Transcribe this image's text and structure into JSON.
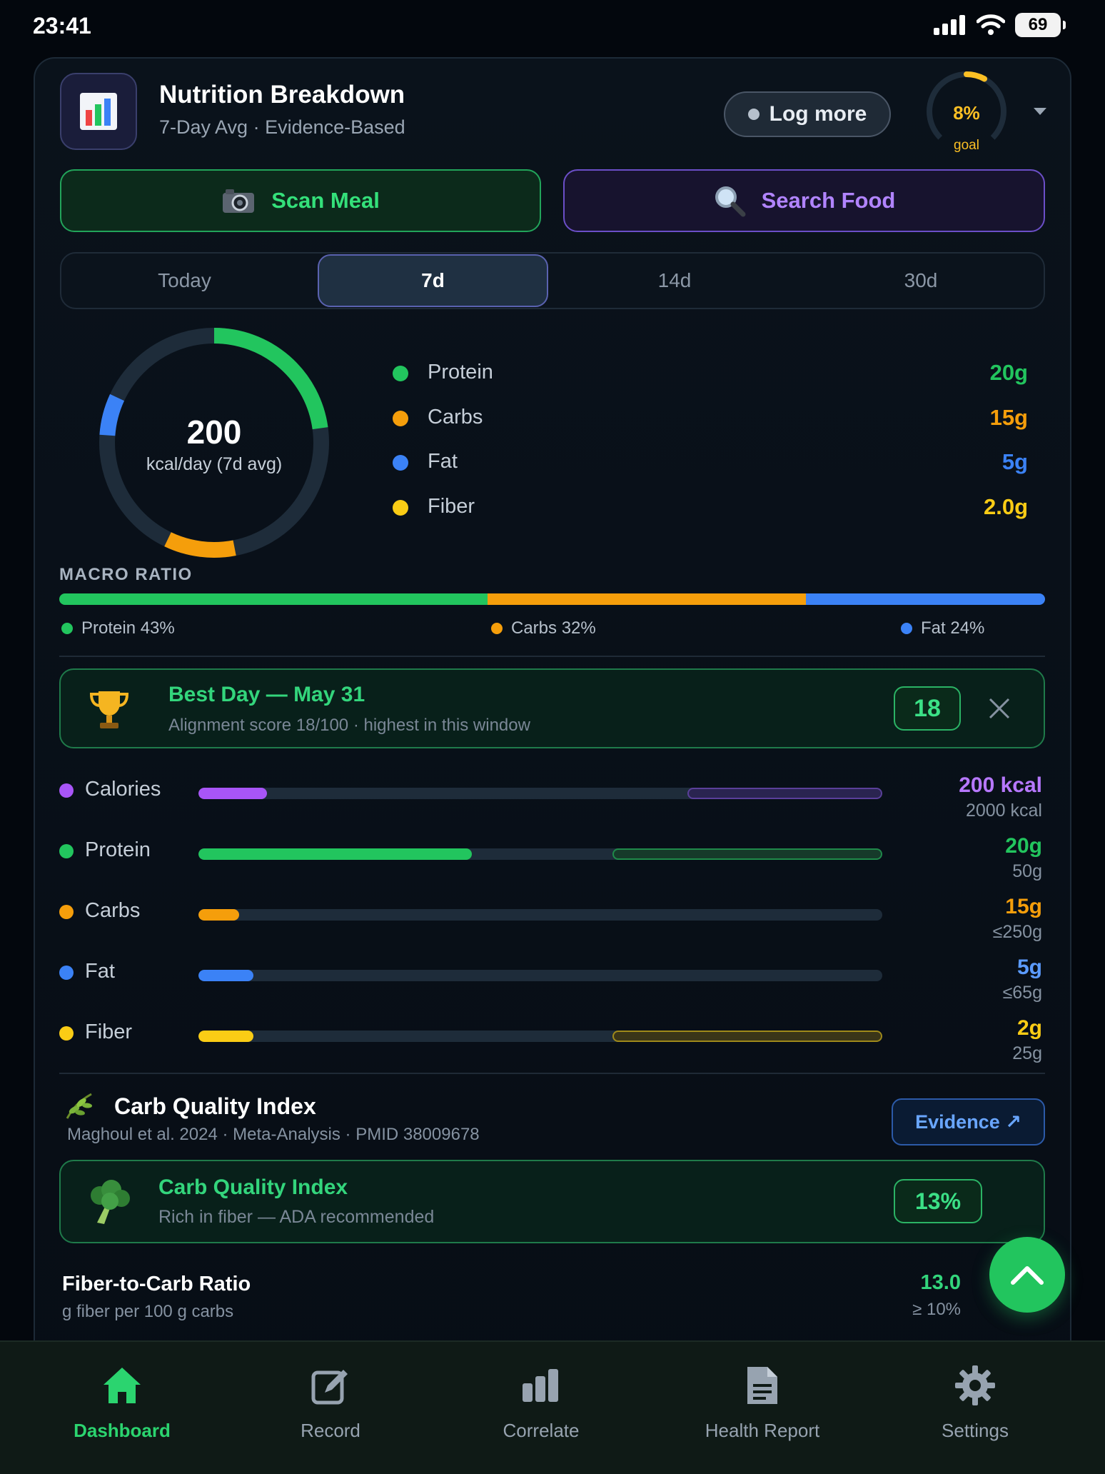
{
  "status": {
    "time": "23:41",
    "battery": "69"
  },
  "header": {
    "title": "Nutrition Breakdown",
    "subtitle": "7-Day Avg · Evidence-Based",
    "log_more": "Log more",
    "goal_pct": "8%",
    "goal_label": "goal",
    "goal_fraction": 0.08
  },
  "actions": {
    "scan": "Scan Meal",
    "search": "Search Food"
  },
  "periods": [
    "Today",
    "7d",
    "14d",
    "30d"
  ],
  "active_period": "7d",
  "ring": {
    "value": "200",
    "unit": "kcal/day (7d avg)"
  },
  "macros": [
    {
      "name": "Protein",
      "value": "20g",
      "color": "#22c55e"
    },
    {
      "name": "Carbs",
      "value": "15g",
      "color": "#f59e0b"
    },
    {
      "name": "Fat",
      "value": "5g",
      "color": "#3b82f6"
    },
    {
      "name": "Fiber",
      "value": "2.0g",
      "color": "#facc15"
    }
  ],
  "macro_ratio": {
    "title": "MACRO RATIO",
    "protein": "Protein 43%",
    "carbs": "Carbs 32%",
    "fat": "Fat 24%",
    "protein_pct": 43,
    "carbs_pct": 32,
    "fat_pct": 24
  },
  "best_day": {
    "title": "Best Day — May 31",
    "subtitle": "Alignment score 18/100 · highest in this window",
    "score": "18"
  },
  "nutrients": [
    {
      "name": "Calories",
      "value": "200 kcal",
      "goal": "2000 kcal",
      "color": "#a855f7",
      "fill": 0.1
    },
    {
      "name": "Protein",
      "value": "20g",
      "goal": "50g",
      "color": "#22c55e",
      "fill": 0.4
    },
    {
      "name": "Carbs",
      "value": "15g",
      "goal": "≤250g",
      "color": "#f59e0b",
      "fill": 0.06
    },
    {
      "name": "Fat",
      "value": "5g",
      "goal": "≤65g",
      "color": "#3b82f6",
      "fill": 0.08
    },
    {
      "name": "Fiber",
      "value": "2g",
      "goal": "25g",
      "color": "#facc15",
      "fill": 0.08
    }
  ],
  "carb_quality": {
    "heading": "Carb Quality Index",
    "citation": "Maghoul et al. 2024 · Meta-Analysis · PMID 38009678",
    "evidence": "Evidence ↗",
    "card_title": "Carb Quality Index",
    "card_sub": "Rich in fiber — ADA recommended",
    "badge": "13%"
  },
  "fiber_ratio": {
    "title": "Fiber-to-Carb Ratio",
    "subtitle": "g fiber per 100 g carbs",
    "value": "13.0",
    "goal": "≥ 10%"
  },
  "tabs": [
    {
      "label": "Dashboard",
      "icon": "home-icon",
      "active": true
    },
    {
      "label": "Record",
      "icon": "edit-icon",
      "active": false
    },
    {
      "label": "Correlate",
      "icon": "bar-chart-icon",
      "active": false
    },
    {
      "label": "Health Report",
      "icon": "document-icon",
      "active": false
    },
    {
      "label": "Settings",
      "icon": "gear-icon",
      "active": false
    }
  ]
}
